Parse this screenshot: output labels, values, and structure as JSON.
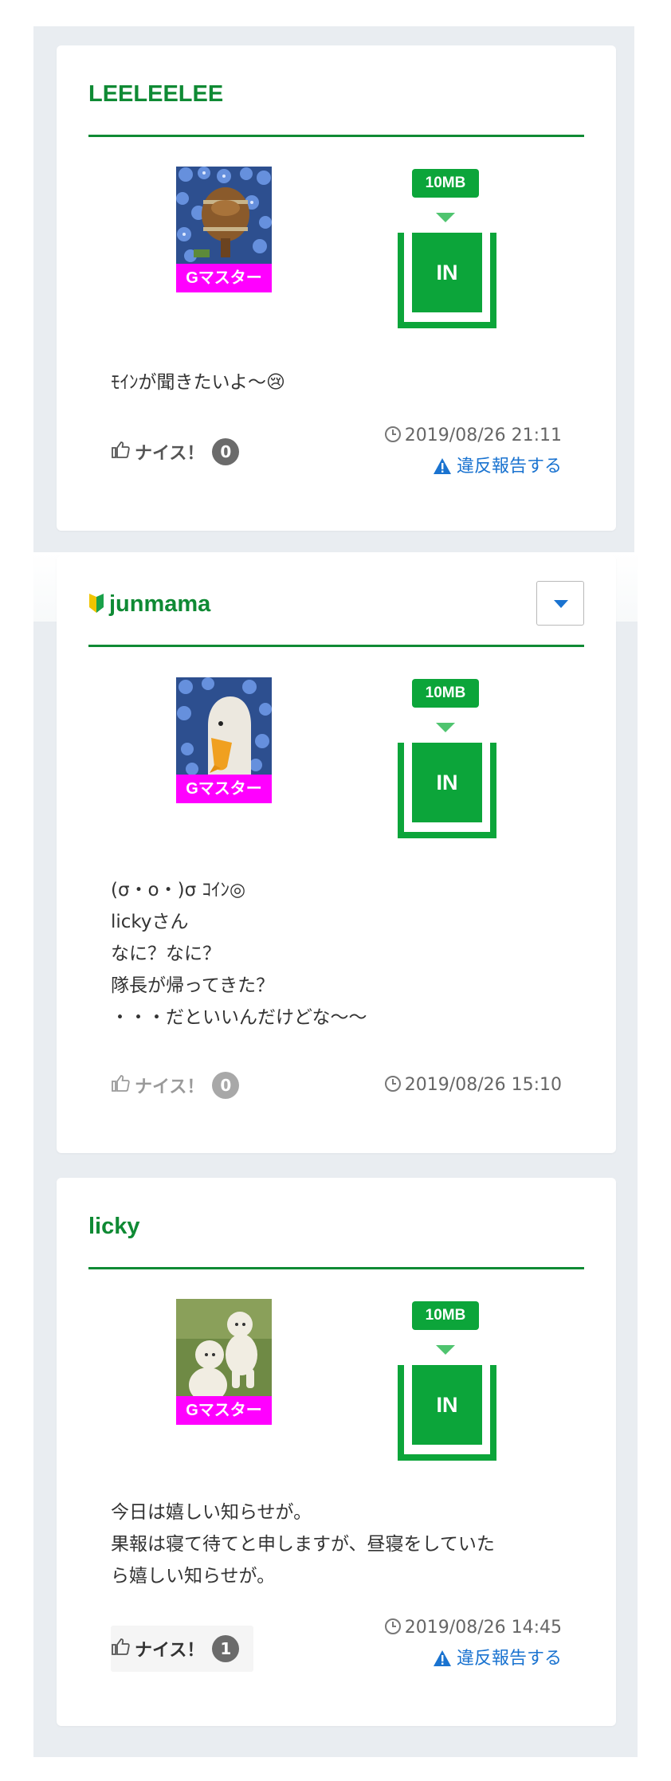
{
  "colors": {
    "brand_green": "#0f8a34",
    "in_green": "#0ca53a",
    "rank_magenta": "#ff00ff",
    "link_blue": "#1a73d0",
    "background": "#e9edf1"
  },
  "posts": [
    {
      "user_name": "LEELEELEE",
      "rank": "Gマスター",
      "size": "10MB",
      "action": "IN",
      "message": [
        "ﾓｲﾝが聞きたいよ〜😢"
      ],
      "like_label": "ナイス！",
      "like_count": "0",
      "date": "2019/08/26 21:11",
      "report": "違反報告する"
    },
    {
      "user_name": "junmama",
      "beginner_icon": "beginner-mark-icon",
      "rank": "Gマスター",
      "size": "10MB",
      "action": "IN",
      "message": [
        "(σ・o・)σ ｺｲﾝ◎",
        "lickyさん",
        "なに？なに？",
        "隊長が帰ってきた？",
        "・・・だといいんだけどな〜〜"
      ],
      "like_label": "ナイス！",
      "like_count": "0",
      "date": "2019/08/26 15:10"
    },
    {
      "user_name": "licky",
      "rank": "Gマスター",
      "size": "10MB",
      "action": "IN",
      "message": [
        "今日は嬉しい知らせが。",
        "果報は寝て待てと申しますが、昼寝をしていた",
        "ら嬉しい知らせが。"
      ],
      "like_label": "ナイス！",
      "like_count": "1",
      "date": "2019/08/26 14:45",
      "report": "違反報告する"
    }
  ]
}
